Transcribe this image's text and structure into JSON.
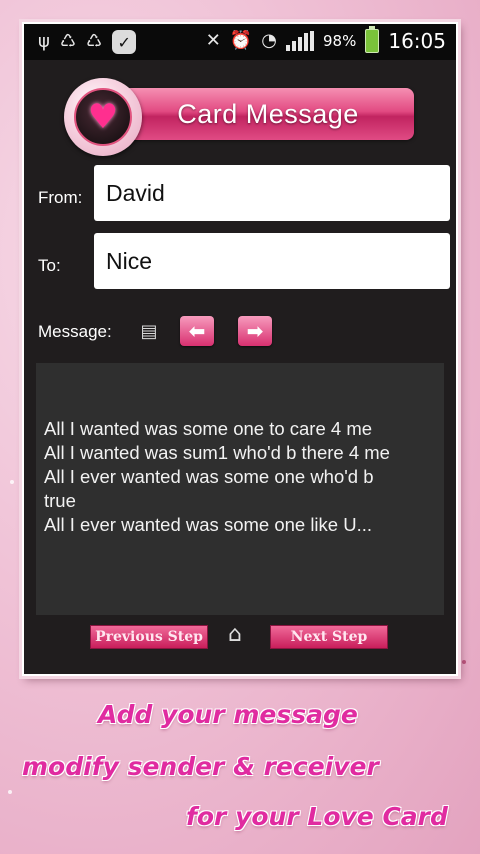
{
  "status_bar": {
    "battery": "98%",
    "time": "16:05",
    "icons": [
      "usb-icon",
      "recycle-icon",
      "recycle-icon",
      "check-icon",
      "mute-icon",
      "alarm-icon",
      "wifi-icon",
      "signal-icon",
      "battery-icon"
    ]
  },
  "header": {
    "title": "Card Message",
    "badge_icon": "heart-icon"
  },
  "form": {
    "from_label": "From:",
    "from_value": "David",
    "to_label": "To:",
    "to_value": "Nice",
    "message_label": "Message:"
  },
  "message": {
    "lines": [
      "All I wanted was some one to care 4 me",
      "All I wanted was sum1 who'd b there 4 me",
      "All I ever wanted was some one who'd b",
      "true",
      "All I ever wanted was some one like U..."
    ]
  },
  "footer": {
    "previous_label": "Previous Step",
    "next_label": "Next Step"
  },
  "caption": {
    "line1": "Add your message",
    "line2": "modify sender & receiver",
    "line3": "for your Love Card"
  },
  "colors": {
    "accent": "#e02ba0",
    "header_pink": "#e24a82",
    "panel": "#201d1e"
  }
}
